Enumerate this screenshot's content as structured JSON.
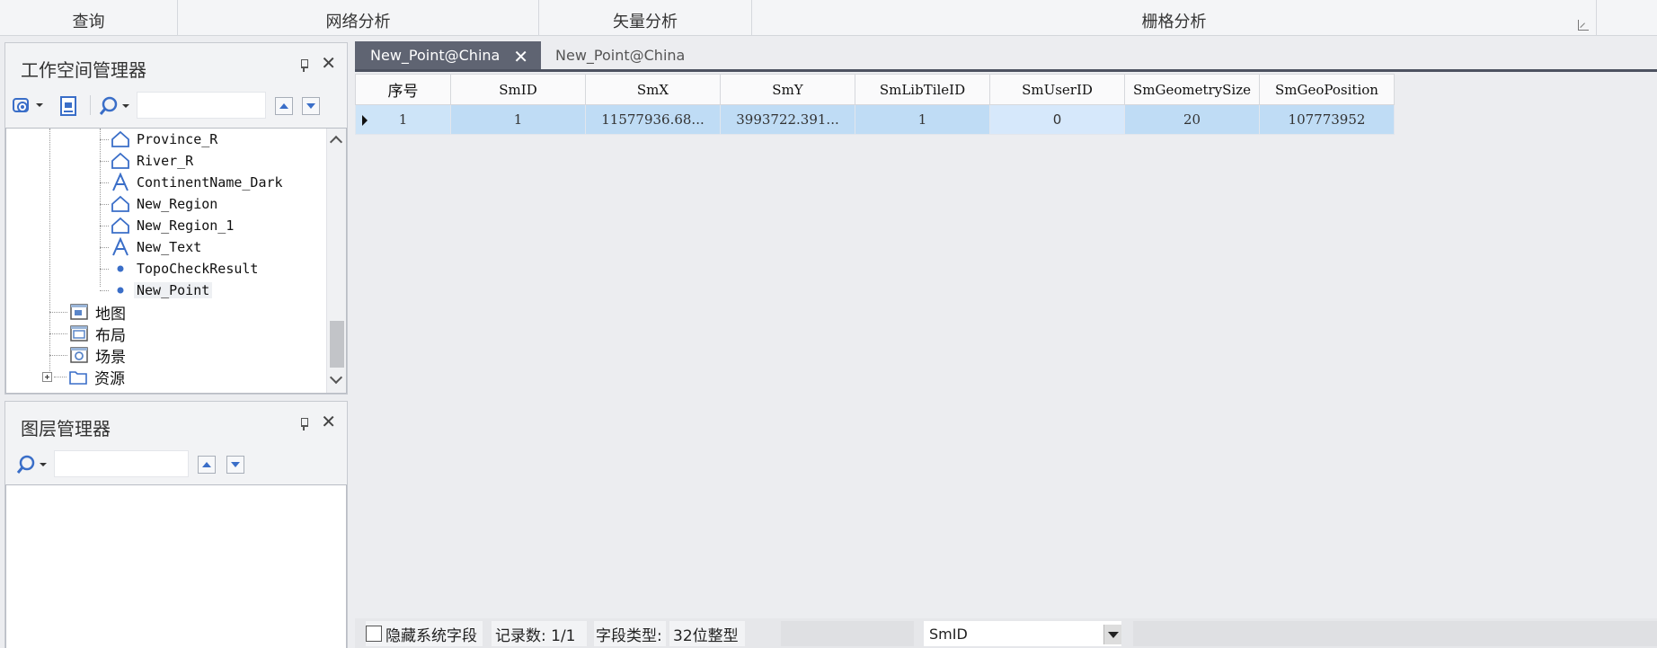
{
  "ribbon": {
    "groups": [
      {
        "label": "查询"
      },
      {
        "label": "网络分析"
      },
      {
        "label": "矢量分析"
      },
      {
        "label": "栅格分析"
      }
    ]
  },
  "workspace_panel": {
    "title": "工作空间管理器",
    "tree": [
      {
        "label": "Province_R",
        "icon": "region-icon"
      },
      {
        "label": "River_R",
        "icon": "region-icon"
      },
      {
        "label": "ContinentName_Dark",
        "icon": "text-icon"
      },
      {
        "label": "New_Region",
        "icon": "region-icon"
      },
      {
        "label": "New_Region_1",
        "icon": "region-icon"
      },
      {
        "label": "New_Text",
        "icon": "text-icon"
      },
      {
        "label": "TopoCheckResult",
        "icon": "point-icon"
      },
      {
        "label": "New_Point",
        "icon": "point-icon"
      },
      {
        "label": "地图",
        "icon": "map-icon"
      },
      {
        "label": "布局",
        "icon": "layout-icon"
      },
      {
        "label": "场景",
        "icon": "scene-icon"
      },
      {
        "label": "资源",
        "icon": "folder-icon"
      }
    ]
  },
  "layer_panel": {
    "title": "图层管理器"
  },
  "tabs": [
    {
      "label": "New_Point@China",
      "active": true
    },
    {
      "label": "New_Point@China",
      "active": false
    }
  ],
  "table": {
    "columns": [
      "序号",
      "SmID",
      "SmX",
      "SmY",
      "SmLibTileID",
      "SmUserID",
      "SmGeometrySize",
      "SmGeoPosition"
    ],
    "rows": [
      [
        "1",
        "1",
        "11577936.68...",
        "3993722.391...",
        "1",
        "0",
        "20",
        "107773952"
      ]
    ]
  },
  "status": {
    "hide_system_fields": "隐藏系统字段",
    "record_count": "记录数: 1/1",
    "field_type_label": "字段类型:",
    "field_type_value": "32位整型",
    "field_select": "SmID"
  },
  "colors": {
    "selected_row": "#bfdcf5",
    "active_tab": "#5f6472",
    "accent_blue": "#3a6ec8"
  }
}
